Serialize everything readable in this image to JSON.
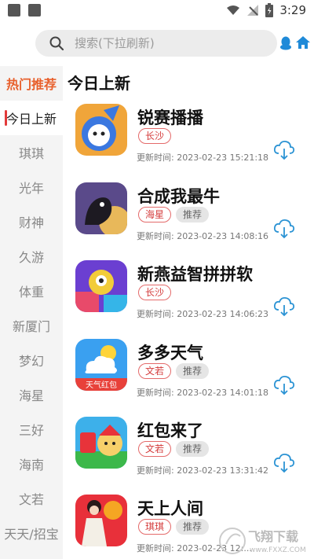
{
  "status_bar": {
    "time": "3:29"
  },
  "search": {
    "placeholder": "搜索(下拉刷新)"
  },
  "sidebar": {
    "items": [
      {
        "label": "热门推荐"
      },
      {
        "label": "今日上新"
      },
      {
        "label": "琪琪"
      },
      {
        "label": "光年"
      },
      {
        "label": "财神"
      },
      {
        "label": "久游"
      },
      {
        "label": "体重"
      },
      {
        "label": "新厦门"
      },
      {
        "label": "梦幻"
      },
      {
        "label": "海星"
      },
      {
        "label": "三好"
      },
      {
        "label": "海南"
      },
      {
        "label": "文若"
      },
      {
        "label": "天天/招宝"
      }
    ]
  },
  "main": {
    "title": "今日上新",
    "update_label": "更新时间:",
    "apps": [
      {
        "name": "锐赛播播",
        "tags": [
          "长沙"
        ],
        "updated": "2023-02-23 15:21:18"
      },
      {
        "name": "合成我最牛",
        "tags": [
          "海星",
          "推荐"
        ],
        "updated": "2023-02-23 14:08:16"
      },
      {
        "name": "新燕益智拼拼软",
        "tags": [
          "长沙"
        ],
        "updated": "2023-02-23 14:06:23"
      },
      {
        "name": "多多天气",
        "tags": [
          "文若",
          "推荐"
        ],
        "updated": "2023-02-23 14:01:18",
        "icon_text": "天气红包"
      },
      {
        "name": "红包来了",
        "tags": [
          "文若",
          "推荐"
        ],
        "updated": "2023-02-23 13:31:42"
      },
      {
        "name": "天上人间",
        "tags": [
          "琪琪",
          "推荐"
        ],
        "updated": "2023-02-23 12:..."
      }
    ]
  },
  "watermark": {
    "text": "飞翔下载",
    "url": "www.FXXZ.COM"
  },
  "colors": {
    "accent": "#e23a3a",
    "hot": "#e8602c",
    "download": "#2b93d4"
  }
}
